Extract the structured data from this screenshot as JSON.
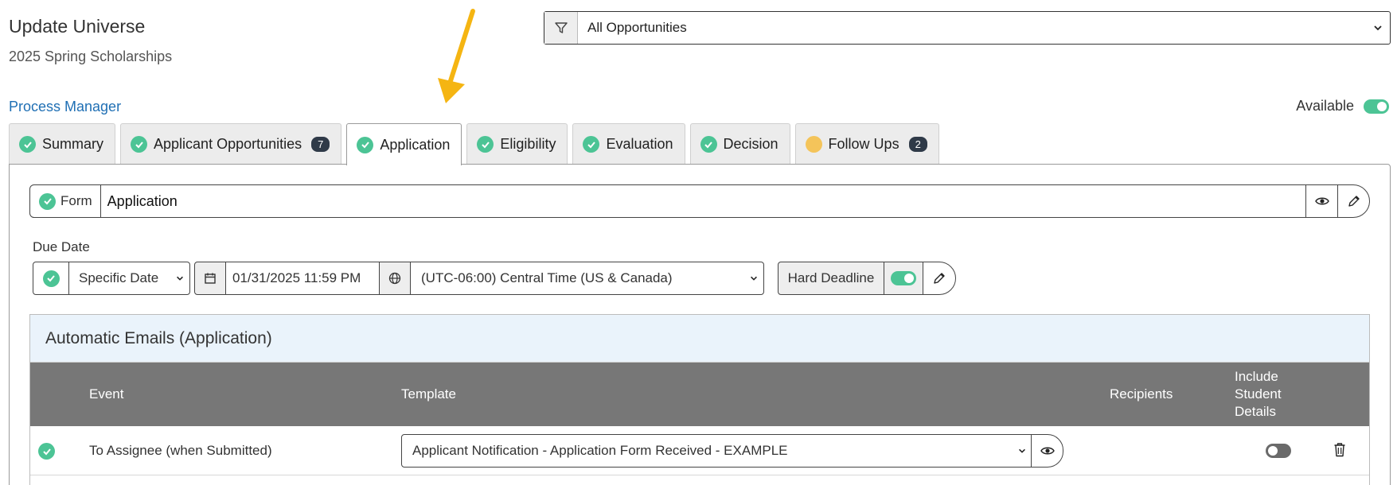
{
  "header": {
    "title": "Update Universe",
    "subtitle": "2025 Spring Scholarships"
  },
  "filter": {
    "icon": "filter-icon",
    "selected": "All Opportunities"
  },
  "nav": {
    "process_manager": "Process Manager",
    "available_label": "Available",
    "available_on": true
  },
  "tabs": [
    {
      "label": "Summary",
      "status": "complete"
    },
    {
      "label": "Applicant Opportunities",
      "status": "complete",
      "badge": "7"
    },
    {
      "label": "Application",
      "status": "complete",
      "active": true
    },
    {
      "label": "Eligibility",
      "status": "complete"
    },
    {
      "label": "Evaluation",
      "status": "complete"
    },
    {
      "label": "Decision",
      "status": "complete"
    },
    {
      "label": "Follow Ups",
      "status": "pending",
      "badge": "2"
    }
  ],
  "form": {
    "label": "Form",
    "value": "Application"
  },
  "due_date": {
    "label": "Due Date",
    "type": "Specific Date",
    "datetime": "01/31/2025 11:59 PM",
    "timezone": "(UTC-06:00) Central Time (US & Canada)",
    "hard_deadline_label": "Hard Deadline",
    "hard_deadline_on": true
  },
  "emails": {
    "title": "Automatic Emails (Application)",
    "columns": {
      "event": "Event",
      "template": "Template",
      "recipients": "Recipients",
      "include_student_details": [
        "Include",
        "Student",
        "Details"
      ]
    },
    "rows": [
      {
        "event": "To Assignee (when Submitted)",
        "template": "Applicant Notification - Application Form Received - EXAMPLE",
        "recipients": "",
        "include_student_details": false
      }
    ]
  },
  "colors": {
    "accent_green": "#4cc495",
    "link_blue": "#1f6fb4",
    "badge_dark": "#2f3a48",
    "pending_yellow": "#f4c45a",
    "table_header": "#777777",
    "annotation_arrow": "#f5b512"
  }
}
